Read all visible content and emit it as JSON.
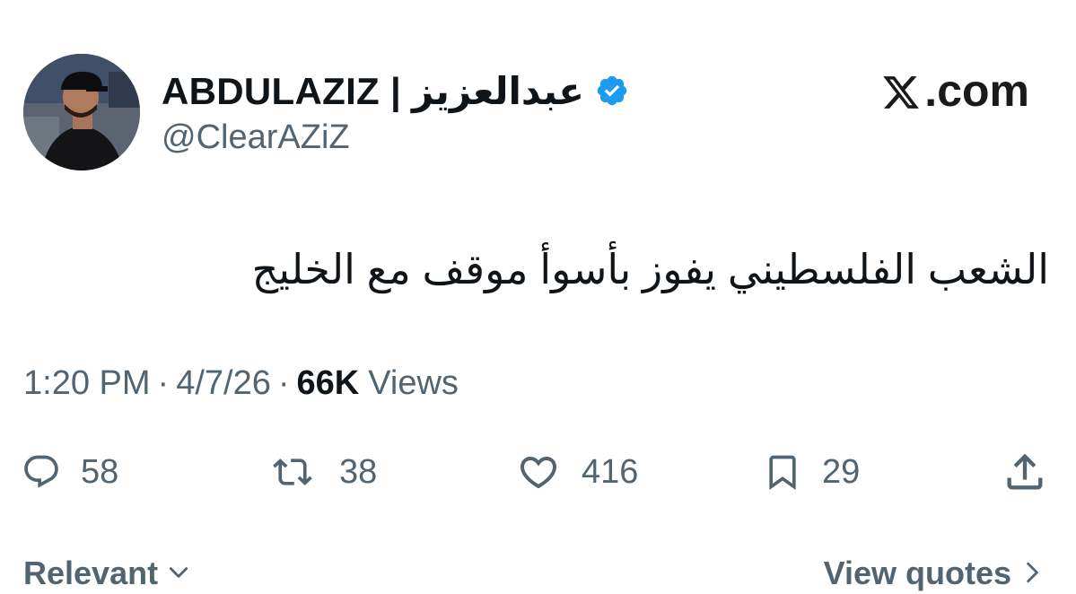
{
  "author": {
    "display_name": "ABDULAZIZ | عبدالعزيز",
    "handle": "@ClearAZiZ",
    "verified": true
  },
  "brand": {
    "label": ".com"
  },
  "tweet": {
    "text": "الشعب الفلسطيني يفوز بأسوأ موقف مع الخليج",
    "time": "1:20 PM",
    "date": "4/7/26",
    "views_count": "66K",
    "views_label": "Views"
  },
  "actions": {
    "replies": "58",
    "reposts": "38",
    "likes": "416",
    "bookmarks": "29"
  },
  "footer": {
    "sort_label": "Relevant",
    "quotes_label": "View quotes"
  },
  "colors": {
    "text": "#0f1419",
    "muted": "#536471",
    "verified": "#1d9bf0"
  }
}
